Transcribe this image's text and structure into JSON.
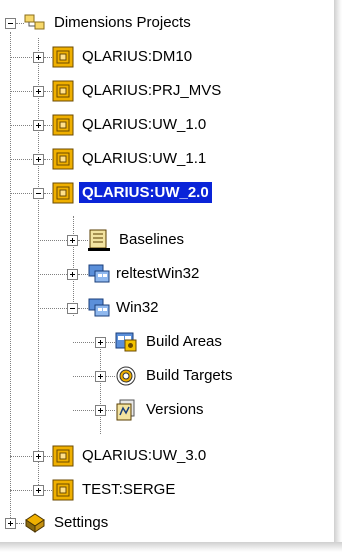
{
  "tree": {
    "root": {
      "label": "Dimensions Projects",
      "icon": "folder-tree-icon"
    },
    "projects": [
      {
        "label": "QLARIUS:DM10",
        "icon": "project-icon",
        "expanded": false
      },
      {
        "label": "QLARIUS:PRJ_MVS",
        "icon": "project-icon",
        "expanded": false
      },
      {
        "label": "QLARIUS:UW_1.0",
        "icon": "project-icon",
        "expanded": false
      },
      {
        "label": "QLARIUS:UW_1.1",
        "icon": "project-icon",
        "expanded": false
      },
      {
        "label": "QLARIUS:UW_2.0",
        "icon": "project-icon",
        "expanded": true,
        "selected": true
      },
      {
        "label": "QLARIUS:UW_3.0",
        "icon": "project-icon",
        "expanded": false
      },
      {
        "label": "TEST:SERGE",
        "icon": "project-icon",
        "expanded": false
      }
    ],
    "children": [
      {
        "label": "Baselines",
        "icon": "baselines-icon"
      },
      {
        "label": "reltestWin32",
        "icon": "build-config-icon"
      },
      {
        "label": "Win32",
        "icon": "build-config-icon"
      }
    ],
    "win32_children": [
      {
        "label": "Build Areas",
        "icon": "build-areas-icon"
      },
      {
        "label": "Build Targets",
        "icon": "build-targets-icon"
      },
      {
        "label": "Versions",
        "icon": "versions-icon"
      }
    ],
    "settings": {
      "label": "Settings",
      "icon": "settings-icon"
    }
  },
  "colors": {
    "selection": "#0a24d8",
    "project_icon": "#f0b000"
  }
}
